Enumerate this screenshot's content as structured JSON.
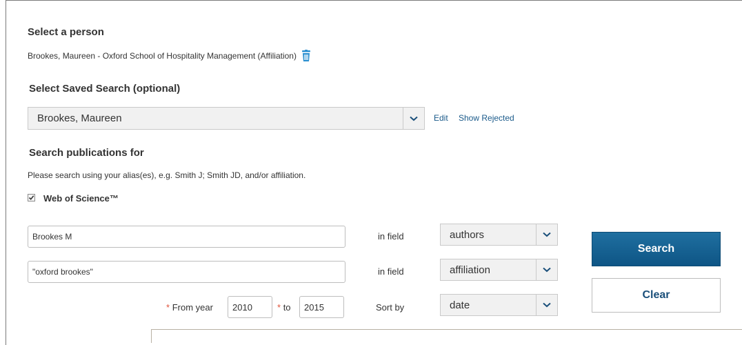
{
  "person_section": {
    "title": "Select a person",
    "person_text": "Brookes, Maureen - Oxford School of Hospitality Management (Affiliation)"
  },
  "saved_search": {
    "title": "Select Saved Search (optional)",
    "selected": "Brookes, Maureen",
    "edit_label": "Edit",
    "show_rejected_label": "Show Rejected"
  },
  "search_section": {
    "title": "Search publications for",
    "hint": "Please search using your alias(es), e.g. Smith J; Smith JD, and/or affiliation.",
    "wos_label": "Web of Science™",
    "wos_checked": true
  },
  "rows": [
    {
      "value": "Brookes M",
      "in_field_label": "in field",
      "field": "authors"
    },
    {
      "value": "\"oxford brookes\"",
      "in_field_label": "in field",
      "field": "affiliation"
    }
  ],
  "years": {
    "required_mark": "*",
    "from_label": "From year",
    "from_value": "2010",
    "to_label": "to",
    "to_value": "2015"
  },
  "sort": {
    "label": "Sort by",
    "value": "date"
  },
  "buttons": {
    "search": "Search",
    "clear": "Clear"
  },
  "colors": {
    "primary": "#0e5585",
    "link": "#1a5a8a",
    "required": "#e0533b"
  }
}
